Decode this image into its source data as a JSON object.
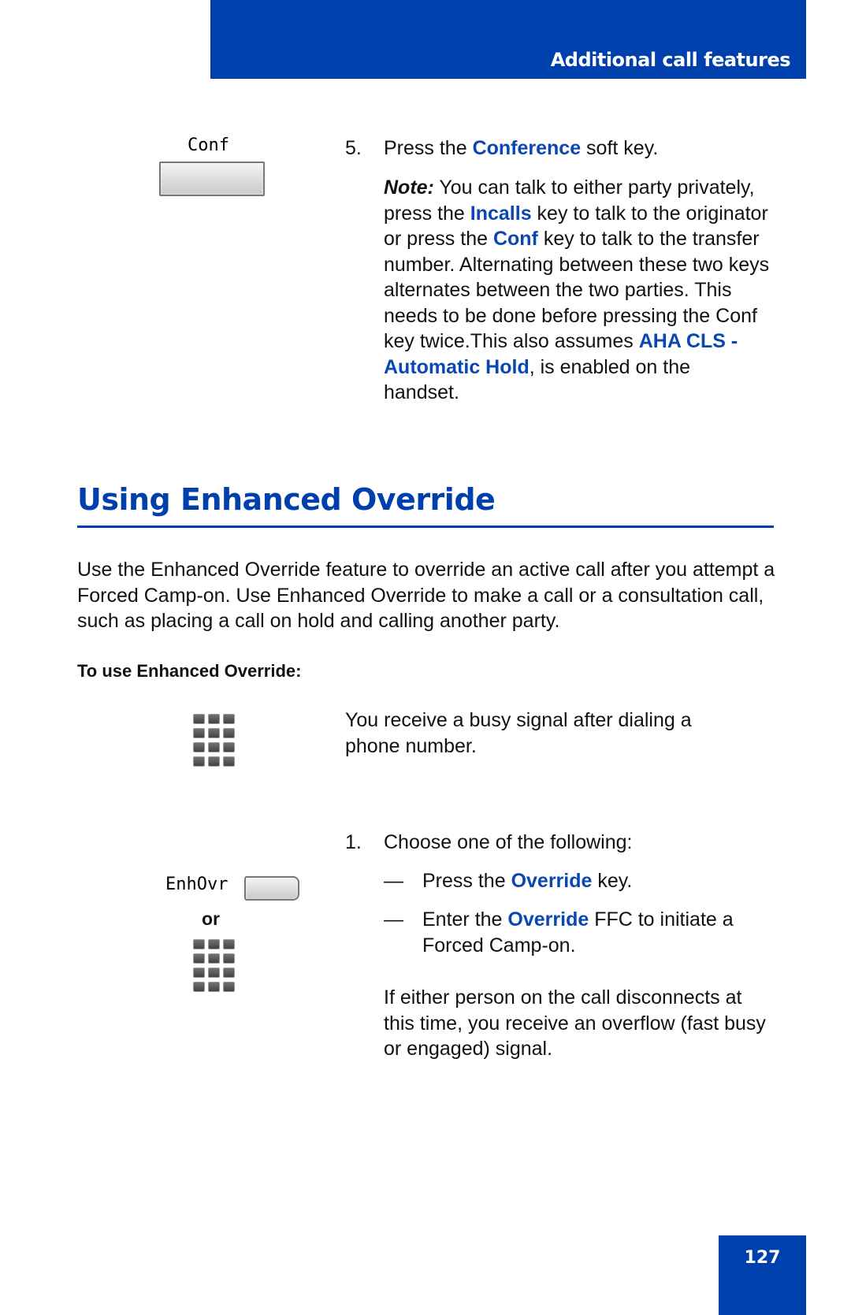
{
  "header": {
    "title": "Additional call features"
  },
  "step5": {
    "softkey_label": "Conf",
    "number": "5.",
    "text_pre": "Press the ",
    "text_key": "Conference",
    "text_post": " soft key.",
    "note": {
      "label": "Note:",
      "parts": [
        " You can talk to either party privately, press the ",
        "Incalls",
        " key to talk to the originator or press the ",
        "Conf",
        " key to talk to the transfer number. Alternating between these two keys alternates between the two parties. This needs to be done before pressing the Conf key twice.This also assumes ",
        "AHA CLS - Automatic Hold",
        ", is enabled on the handset."
      ]
    }
  },
  "section": {
    "title": "Using Enhanced Override",
    "intro": "Use the Enhanced Override feature to override an active call after you attempt a Forced Camp-on. Use Enhanced Override to make a call or a consultation call, such as placing a call on hold and calling another party.",
    "procedure_heading": "To use Enhanced Override:",
    "precondition": "You receive a busy signal after dialing a phone number.",
    "step1": {
      "number": "1.",
      "text": "Choose one of the following:",
      "options": [
        {
          "dash": "—",
          "pre": "Press the ",
          "key": "Override",
          "post": " key."
        },
        {
          "dash": "—",
          "pre": "Enter the ",
          "key": "Override",
          "post": " FFC to initiate a Forced Camp-on."
        }
      ],
      "followup": "If either person on the call disconnects at this time, you receive an overflow (fast busy or engaged) signal."
    },
    "softkey_label": "EnhOvr",
    "or_label": "or"
  },
  "footer": {
    "page_number": "127"
  },
  "colors": {
    "brand_blue": "#0040ad",
    "link_blue": "#0a47b2"
  }
}
